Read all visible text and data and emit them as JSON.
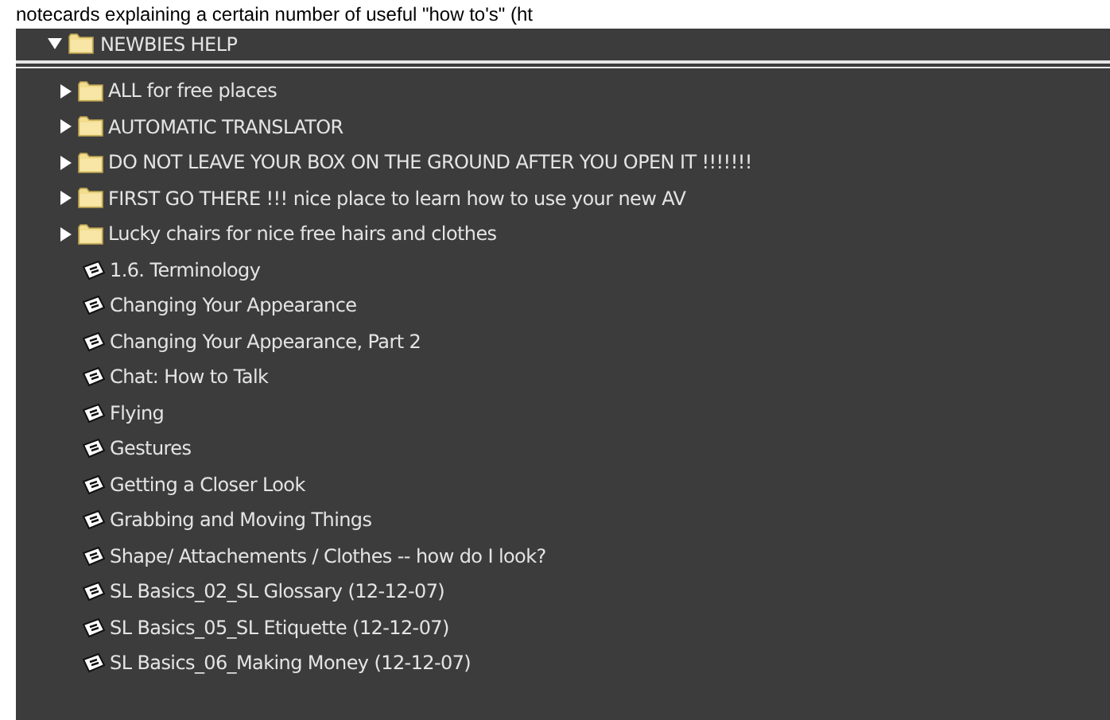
{
  "caption": "notecards explaining a certain number of useful \"how to's\" (ht",
  "tree": {
    "kind": "folder",
    "label": "NEWBIES HELP",
    "expanded": true,
    "children": [
      {
        "kind": "folder",
        "label": "ALL for free places",
        "expanded": false
      },
      {
        "kind": "folder",
        "label": "AUTOMATIC TRANSLATOR",
        "expanded": false
      },
      {
        "kind": "folder",
        "label": "DO NOT LEAVE YOUR BOX ON THE GROUND AFTER YOU OPEN IT !!!!!!!",
        "expanded": false
      },
      {
        "kind": "folder",
        "label": "FIRST GO THERE !!! nice place to learn how to use your new AV",
        "expanded": false
      },
      {
        "kind": "folder",
        "label": "Lucky chairs for nice free hairs and clothes",
        "expanded": false
      },
      {
        "kind": "notecard",
        "label": "1.6. Terminology"
      },
      {
        "kind": "notecard",
        "label": "Changing Your Appearance"
      },
      {
        "kind": "notecard",
        "label": "Changing Your Appearance, Part 2"
      },
      {
        "kind": "notecard",
        "label": "Chat: How to Talk"
      },
      {
        "kind": "notecard",
        "label": "Flying"
      },
      {
        "kind": "notecard",
        "label": "Gestures"
      },
      {
        "kind": "notecard",
        "label": "Getting a Closer Look"
      },
      {
        "kind": "notecard",
        "label": "Grabbing and Moving Things"
      },
      {
        "kind": "notecard",
        "label": "Shape/ Attachements / Clothes -- how do I look?"
      },
      {
        "kind": "notecard",
        "label": "SL Basics_02_SL Glossary (12-12-07)"
      },
      {
        "kind": "notecard",
        "label": "SL Basics_05_SL Etiquette (12-12-07)"
      },
      {
        "kind": "notecard",
        "label": "SL Basics_06_Making Money (12-12-07)"
      }
    ]
  }
}
